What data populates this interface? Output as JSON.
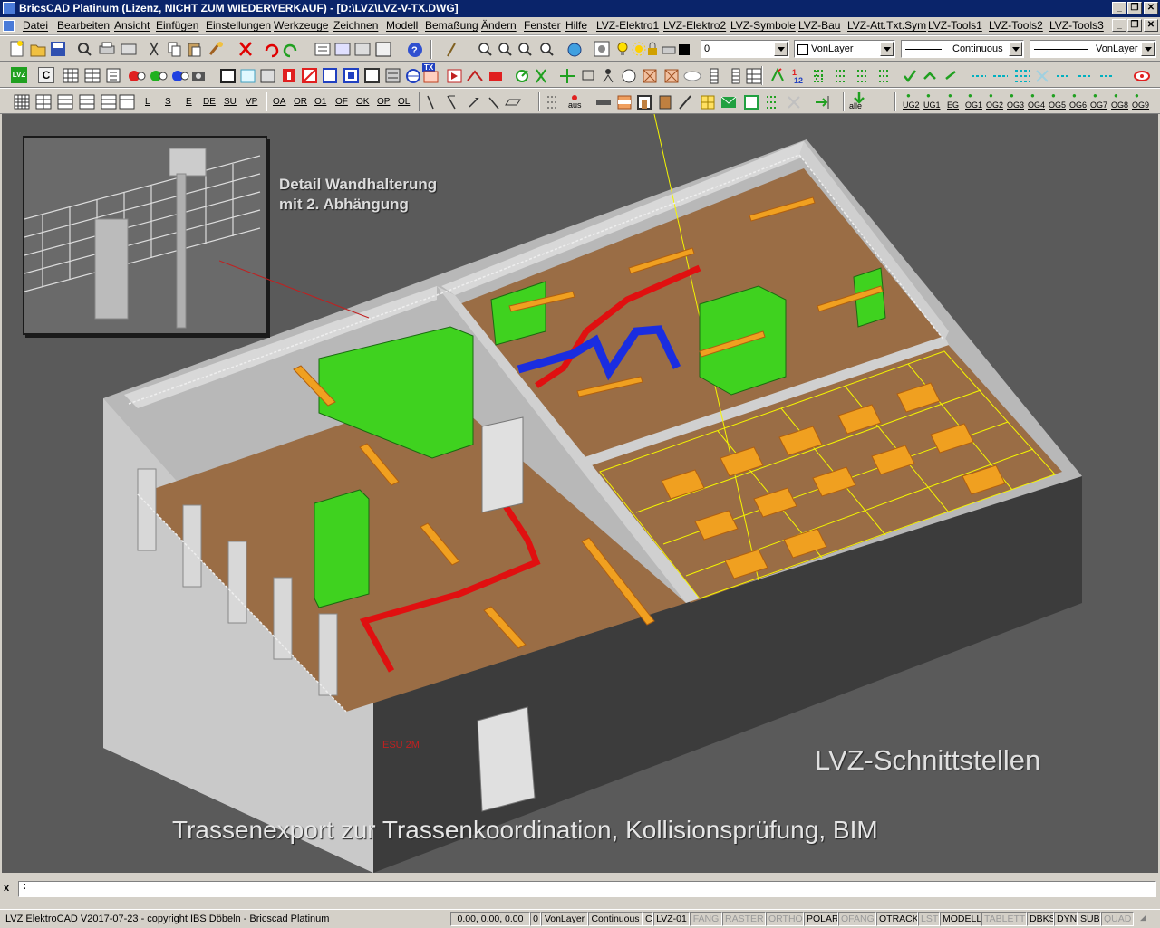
{
  "window": {
    "title": "BricsCAD Platinum (Lizenz, NICHT ZUM WIEDERVERKAUF) - [D:\\LVZ\\LVZ-V-TX.DWG]",
    "minimize": "_",
    "restore": "❐",
    "close": "✕"
  },
  "menu": {
    "items": [
      "Datei",
      "Bearbeiten",
      "Ansicht",
      "Einfügen",
      "Einstellungen",
      "Werkzeuge",
      "Zeichnen",
      "Modell",
      "Bemaßung",
      "Ändern",
      "Fenster",
      "Hilfe",
      "LVZ-Elektro1",
      "LVZ-Elektro2",
      "LVZ-Symbole",
      "LVZ-Bau",
      "LVZ-Att.Txt.Sym",
      "LVZ-Tools1",
      "LVZ-Tools2",
      "LVZ-Tools3"
    ]
  },
  "toolbar1": {
    "color_value": "0",
    "layer_value": "VonLayer",
    "linetype_value": "Continuous",
    "lineweight_value": "VonLayer"
  },
  "toolbar2": {
    "lvz_label": "LVZ",
    "c_label": "C",
    "tx_label": "TX"
  },
  "toolbar3": {
    "letters": [
      "L",
      "S",
      "E",
      "DE",
      "SU",
      "VP"
    ],
    "codes": [
      "OA",
      "OR",
      "O1",
      "OF",
      "OK",
      "OP",
      "OL"
    ],
    "aus_label": "aus",
    "alle_label": "alle",
    "floors": [
      "UG2",
      "UG1",
      "EG",
      "OG1",
      "OG2",
      "OG3",
      "OG4",
      "OG5",
      "OG6",
      "OG7",
      "OG8",
      "OG9"
    ]
  },
  "viewport": {
    "detail_caption_line1": "Detail Wandhalterung",
    "detail_caption_line2": "mit 2. Abhängung",
    "heading": "LVZ-Schnittstellen",
    "subheading": "Trassenexport zur Trassenkoordination, Kollisionsprüfung, BIM",
    "dim_text": "ESU 2M",
    "floor_color": "#9a6d45",
    "wall_color": "#c8c8c8",
    "cabinet_color": "#3fd21f",
    "pipe_red": "#e01010",
    "pipe_blue": "#1a2de0",
    "tray_color": "#f0a020",
    "grid_color": "#f5f500"
  },
  "command": {
    "prompt": ":",
    "close": "x"
  },
  "status": {
    "app_info": "LVZ ElektroCAD V2017-07-23 - copyright IBS Döbeln - Bricscad Platinum",
    "coords": "0.00, 0.00, 0.00",
    "layer": "0",
    "color": "VonLayer",
    "linetype": "Continuous",
    "style": "C",
    "dimstyle": "LVZ-01",
    "toggles": [
      {
        "label": "FANG",
        "on": false
      },
      {
        "label": "RASTER",
        "on": false
      },
      {
        "label": "ORTHO",
        "on": false
      },
      {
        "label": "POLAR",
        "on": true
      },
      {
        "label": "OFANG",
        "on": false
      },
      {
        "label": "OTRACK",
        "on": true
      },
      {
        "label": "LST",
        "on": false
      },
      {
        "label": "MODELL",
        "on": true
      },
      {
        "label": "TABLETT",
        "on": false
      },
      {
        "label": "DBKS",
        "on": true
      },
      {
        "label": "DYN",
        "on": true
      },
      {
        "label": "SUB",
        "on": true
      },
      {
        "label": "QUAD",
        "on": false
      }
    ]
  }
}
